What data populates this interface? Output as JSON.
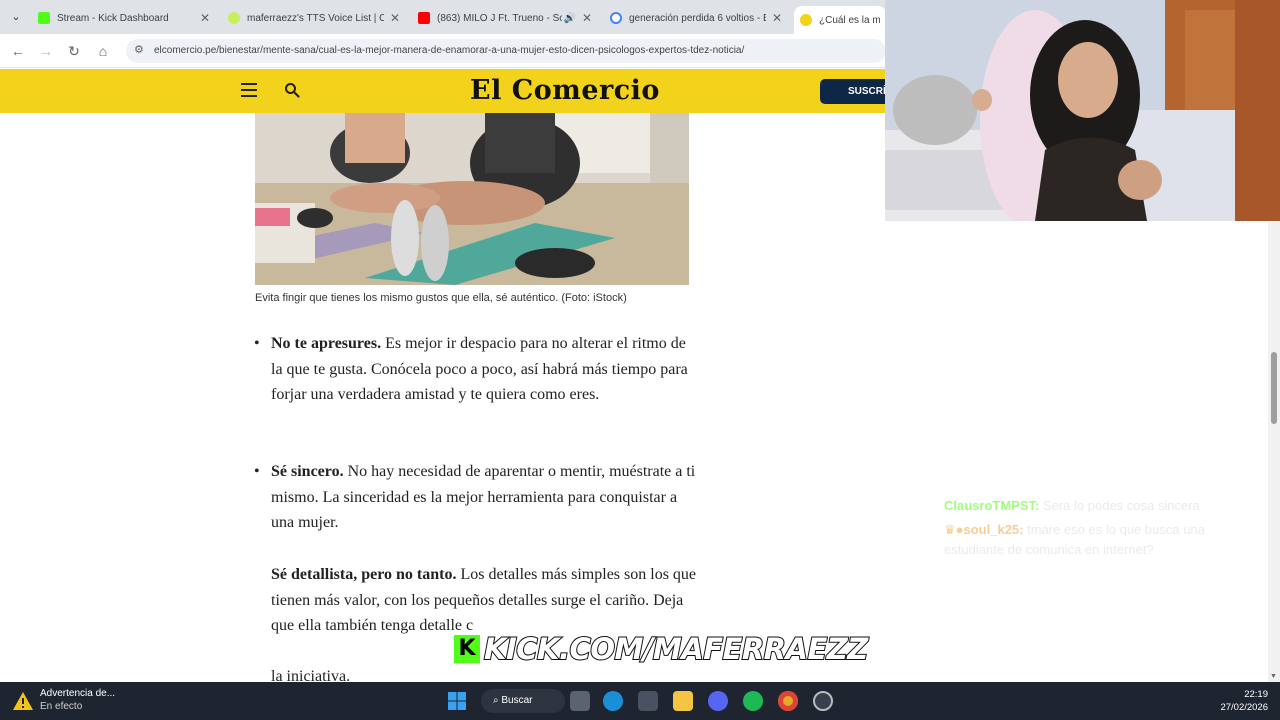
{
  "browser": {
    "tabs": [
      {
        "title": "Stream - Kick Dashboard",
        "favicon_color": "#53fc18"
      },
      {
        "title": "maferraezz's TTS Voice List | Ca",
        "favicon_color": "#c6f05a"
      },
      {
        "title": "(863) MILO J Ft. Trueno - So",
        "favicon_color": "#ff0000"
      },
      {
        "title": "generación perdida 6 voltios - B",
        "favicon_color": "#4285f4"
      },
      {
        "title": "¿Cuál es la mejo",
        "favicon_color": "#f3d21c"
      }
    ],
    "url": "elcomercio.pe/bienestar/mente-sana/cual-es-la-mejor-manera-de-enamorar-a-una-mujer-esto-dicen-psicologos-expertos-tdez-noticia/"
  },
  "site": {
    "logo": "El Comercio",
    "subscribe_label": "SUSCRÍ",
    "brand_color": "#f3d21c"
  },
  "article": {
    "caption": "Evita fingir que tienes los mismo gustos que ella, sé auténtico. (Foto: iStock)",
    "bullets": [
      {
        "bold": "No te apresures.",
        "text": " Es mejor ir despacio para no alterar el ritmo de la que te gusta. Conócela poco a poco, así habrá más tiempo para forjar una verdadera amistad y te quiera como eres."
      },
      {
        "bold": "Sé sincero.",
        "text": " No hay necesidad de aparentar o mentir, muéstrate a ti mismo. La sinceridad es la mejor herramienta para conquistar a una mujer."
      },
      {
        "bold": "Sé detallista, pero no tanto.",
        "text": " Los detalles más simples son los que tienen más valor, con los pequeños detalles surge el cariño. Deja que ella también tenga detalle c"
      },
      {
        "bold": "",
        "text": "la iniciativa."
      }
    ]
  },
  "chat": {
    "messages": [
      {
        "user": "ClausroTMPST:",
        "text": " Sera lo podes cosa sincera"
      },
      {
        "user": "soul_k25:",
        "text": " tmare eso es lo que busca una estudiante de comunica en internet?"
      }
    ]
  },
  "watermark": {
    "text": "KICK.COM/MAFERRAEZZ"
  },
  "taskbar": {
    "warning_title": "Advertencia de...",
    "warning_sub": "En efecto",
    "search_label": "Buscar",
    "time": "22:19",
    "date": "27/02/2026"
  }
}
